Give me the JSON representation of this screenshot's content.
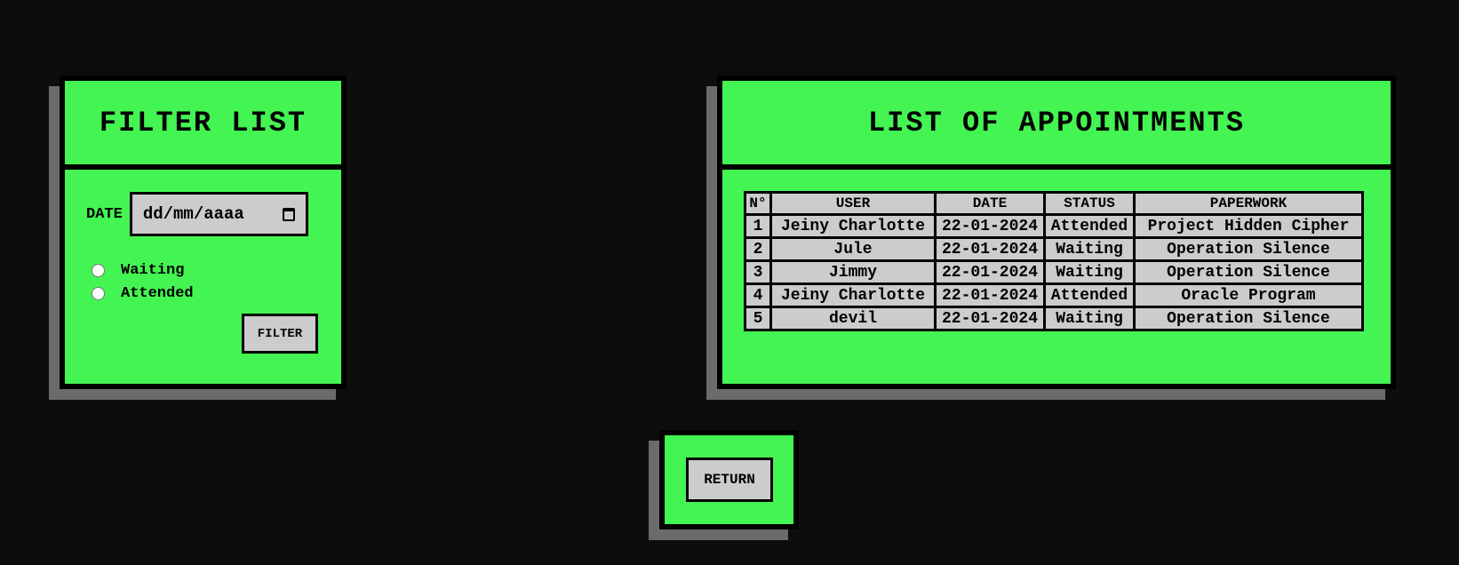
{
  "filter": {
    "title": "FILTER LIST",
    "date_label": "DATE",
    "date_placeholder": "dd/mm/aaaa",
    "radio_options": [
      "Waiting",
      "Attended"
    ],
    "button_label": "FILTER"
  },
  "appointments": {
    "title": "LIST OF APPOINTMENTS",
    "columns": [
      "N°",
      "USER",
      "DATE",
      "STATUS",
      "PAPERWORK"
    ],
    "rows": [
      [
        "1",
        "Jeiny Charlotte",
        "22-01-2024",
        "Attended",
        "Project Hidden Cipher"
      ],
      [
        "2",
        "Jule",
        "22-01-2024",
        "Waiting",
        "Operation Silence"
      ],
      [
        "3",
        "Jimmy",
        "22-01-2024",
        "Waiting",
        "Operation Silence"
      ],
      [
        "4",
        "Jeiny Charlotte",
        "22-01-2024",
        "Attended",
        "Oracle Program"
      ],
      [
        "5",
        "devil",
        "22-01-2024",
        "Waiting",
        "Operation Silence"
      ]
    ]
  },
  "return": {
    "button_label": "RETURN"
  },
  "colors": {
    "background": "#0d0d0d",
    "panel": "#44f453",
    "shadow": "#6b6b6b",
    "control": "#cccccc",
    "border": "#000000"
  },
  "icons": {
    "date_picker": "calendar-icon"
  }
}
